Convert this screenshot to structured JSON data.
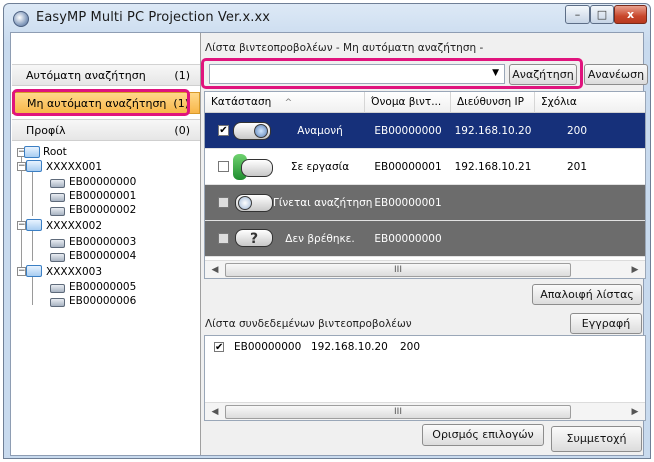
{
  "window": {
    "title": "EasyMP Multi PC Projection Ver.x.xx",
    "buttons": {
      "minimize": "–",
      "maximize": "□",
      "close": "x"
    }
  },
  "sidebar": {
    "categories": [
      {
        "label": "Αυτόματη αναζήτηση",
        "count": "(1)"
      },
      {
        "label": "Μη αυτόματη αναζήτηση",
        "count": "(1)"
      },
      {
        "label": "Προφίλ",
        "count": "(0)"
      }
    ],
    "tree": {
      "root": "Root",
      "groups": [
        {
          "name": "XXXXX001",
          "items": [
            "EB00000000",
            "EB00000001",
            "EB00000002"
          ]
        },
        {
          "name": "XXXXX002",
          "items": [
            "EB00000003",
            "EB00000004"
          ]
        },
        {
          "name": "XXXXX003",
          "items": [
            "EB00000005",
            "EB00000006"
          ]
        }
      ]
    }
  },
  "main": {
    "list_title": "Λίστα βιντεοπροβολέων - Μη αυτόματη αναζήτηση -",
    "search_value": "",
    "search_button": "Αναζήτηση",
    "refresh_button": "Ανανέωση",
    "columns": [
      "Κατάσταση",
      "Όνομα βιντ...",
      "Διεύθυνση IP",
      "Σχόλια"
    ],
    "sort_indicator": "^",
    "rows": [
      {
        "checked": "✔",
        "status": "Αναμονή",
        "name": "EB00000000",
        "ip": "192.168.10.20",
        "comment": "200",
        "style": "selected"
      },
      {
        "checked": "",
        "status": "Σε εργασία",
        "name": "EB00000001",
        "ip": "192.168.10.21",
        "comment": "201",
        "style": "normal"
      },
      {
        "checked": "",
        "status": "Γίνεται αναζήτηση",
        "name": "EB00000001",
        "ip": "",
        "comment": "",
        "style": "gray"
      },
      {
        "checked": "",
        "status": "Δεν βρέθηκε.",
        "name": "EB00000000",
        "ip": "",
        "comment": "",
        "style": "gray"
      }
    ],
    "clear_button": "Απαλοιφή λίστας",
    "connected_title": "Λίστα συνδεδεμένων βιντεοπροβολέων",
    "register_button": "Εγγραφή",
    "connected_rows": [
      {
        "checked": "✔",
        "name": "EB00000000",
        "ip": "192.168.10.20",
        "comment": "200"
      }
    ],
    "options_button": "Ορισμός επιλογών",
    "join_button": "Συμμετοχή",
    "scroll_thumb": "III",
    "scroll_left": "◀",
    "scroll_right": "▶",
    "combo_arrow": "▼"
  }
}
